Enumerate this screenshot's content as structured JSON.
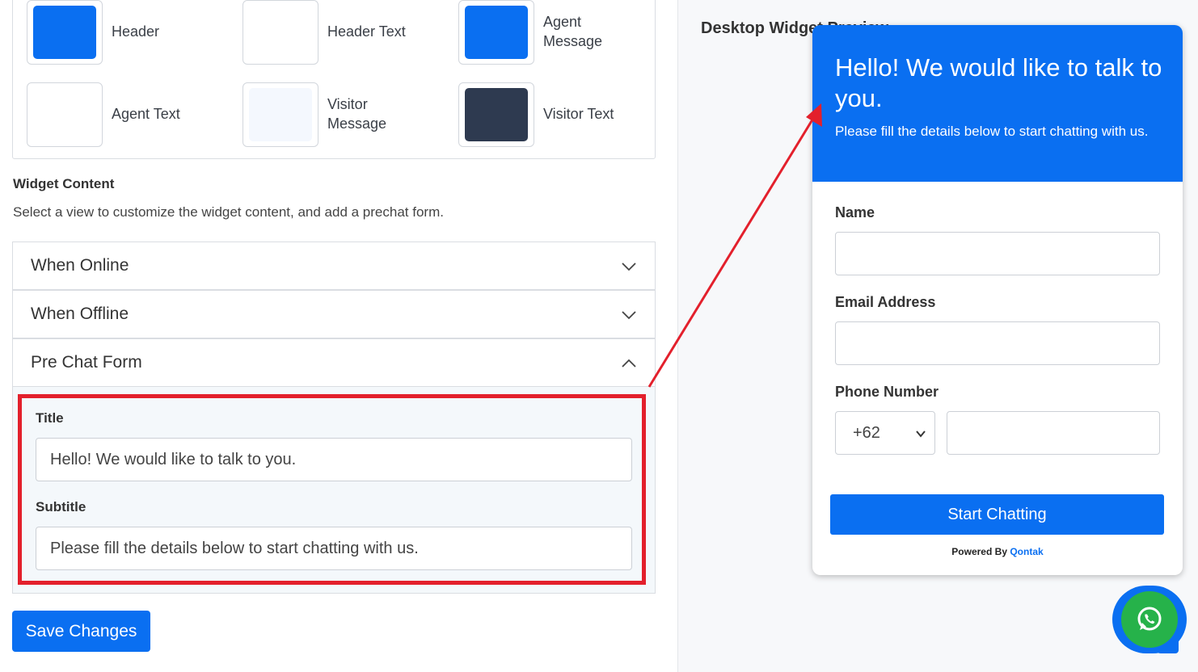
{
  "colors": [
    {
      "label": "Header",
      "color": "#0a6ff1"
    },
    {
      "label": "Header Text",
      "color": "#ffffff"
    },
    {
      "label": "Agent Message",
      "color": "#0a6ff1"
    },
    {
      "label": "Agent Text",
      "color": "#ffffff"
    },
    {
      "label": "Visitor Message",
      "color": "#f4f8fe"
    },
    {
      "label": "Visitor Text",
      "color": "#2e3a50"
    }
  ],
  "widget_content": {
    "title": "Widget Content",
    "description": "Select a view to customize the widget content, and add a prechat form."
  },
  "accordion": [
    {
      "label": "When Online",
      "expanded": false
    },
    {
      "label": "When Offline",
      "expanded": false
    },
    {
      "label": "Pre Chat Form",
      "expanded": true
    }
  ],
  "prechat": {
    "title_label": "Title",
    "title_value": "Hello! We would like to talk to you.",
    "subtitle_label": "Subtitle",
    "subtitle_value": "Please fill the details below to start chatting with us."
  },
  "save_button": "Save Changes",
  "preview": {
    "heading": "Desktop Widget Preview",
    "widget_title": "Hello! We would like to talk to you.",
    "widget_subtitle": "Please fill the details below to start chatting with us.",
    "name_label": "Name",
    "email_label": "Email Address",
    "phone_label": "Phone Number",
    "country_code": "+62",
    "start_button": "Start Chatting",
    "powered_by": "Powered By",
    "brand": "Qontak"
  },
  "accent_color": "#0a6ff1",
  "highlight_color": "#e3202c",
  "whatsapp_color": "#26b24a"
}
